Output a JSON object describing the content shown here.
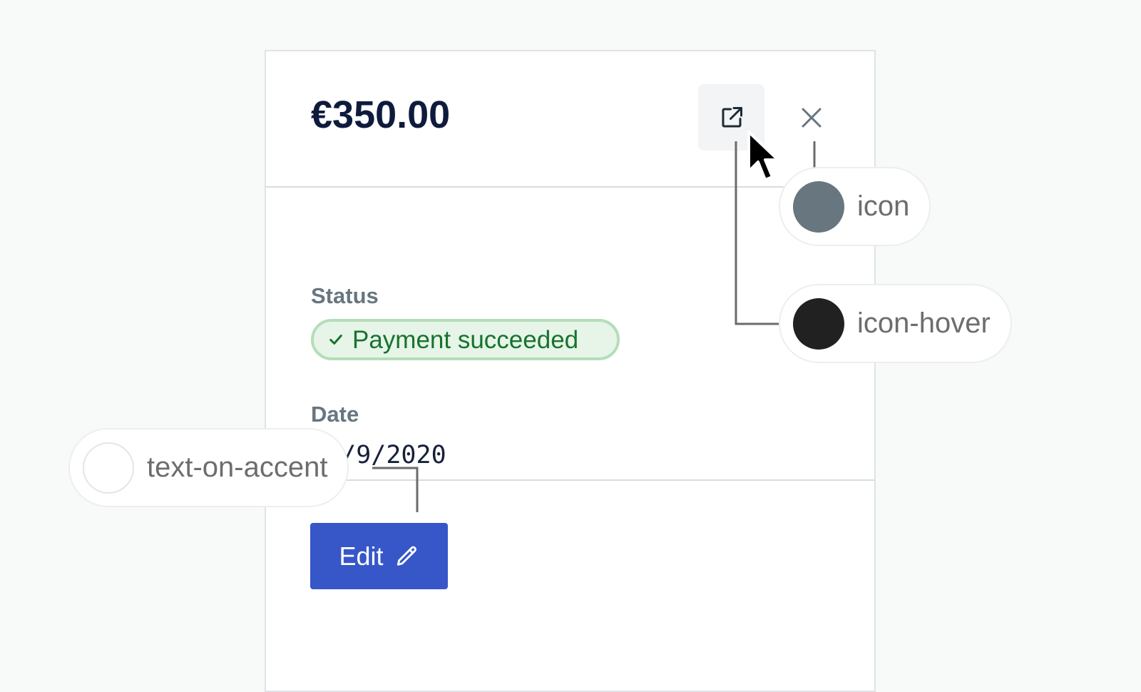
{
  "panel": {
    "amount": "€350.00",
    "open_icon": "external-link-icon",
    "close_icon": "close-icon",
    "status": {
      "label": "Status",
      "badge_text": "Payment succeeded",
      "badge_icon": "check-icon"
    },
    "date": {
      "label": "Date",
      "value": "15/9/2020"
    },
    "edit_button": {
      "label": "Edit",
      "icon": "pencil-icon"
    }
  },
  "callouts": [
    {
      "label": "icon",
      "color": "#67767f"
    },
    {
      "label": "icon-hover",
      "color": "#212121"
    },
    {
      "label": "text-on-accent",
      "color": "#ffffff"
    }
  ],
  "colors": {
    "accent": "#3757c8",
    "success_text": "#17732d",
    "success_bg": "#e6f5e8",
    "heading": "#0f1b3d",
    "muted_label": "#67767f"
  }
}
